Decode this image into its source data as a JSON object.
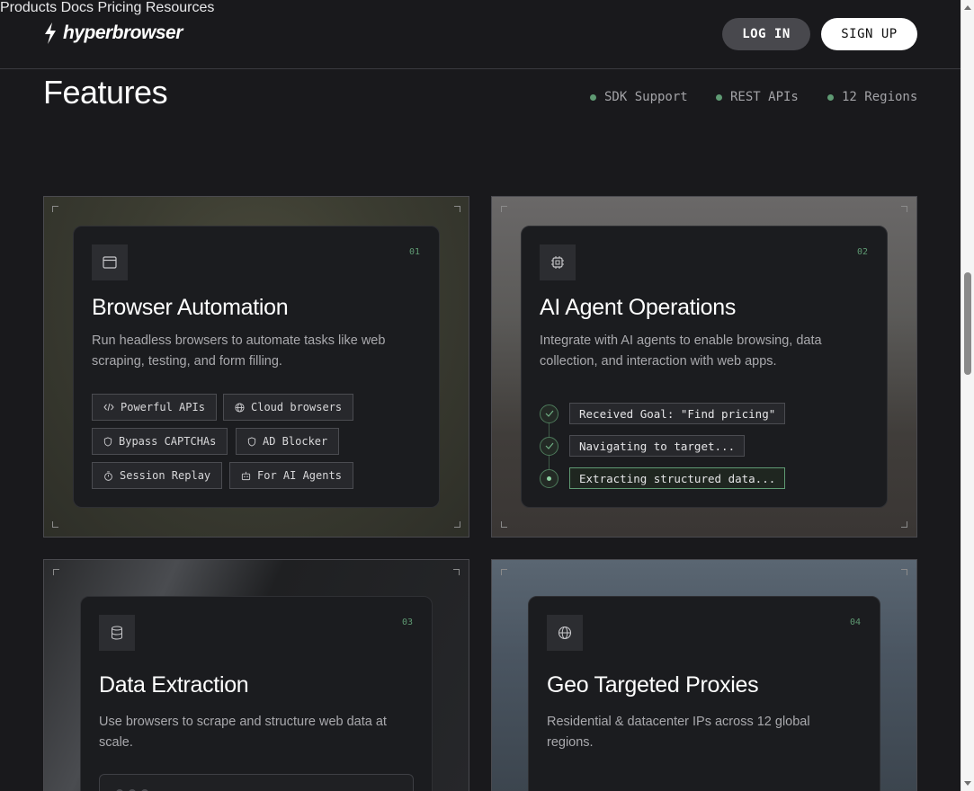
{
  "nav": {
    "logo_text": "hyperbrowser",
    "links": [
      "Products",
      "Docs",
      "Pricing",
      "Resources"
    ],
    "login_label": "LOG IN",
    "signup_label": "SIGN UP"
  },
  "header": {
    "title": "Features",
    "badges": [
      "SDK Support",
      "REST APIs",
      "12 Regions"
    ]
  },
  "colors": {
    "accent": "#5f9a73",
    "background": "#19191c",
    "card": "#1b1c1f"
  },
  "features": [
    {
      "num": "01",
      "icon": "browser-window-icon",
      "title": "Browser Automation",
      "desc": "Run headless browsers to automate tasks like web scraping, testing, and form filling.",
      "tags": [
        {
          "icon": "code-icon",
          "label": "Powerful APIs"
        },
        {
          "icon": "globe-icon",
          "label": "Cloud browsers"
        },
        {
          "icon": "shield-icon",
          "label": "Bypass CAPTCHAs"
        },
        {
          "icon": "shield-icon",
          "label": "AD Blocker"
        },
        {
          "icon": "timer-icon",
          "label": "Session Replay"
        },
        {
          "icon": "robot-icon",
          "label": "For AI Agents"
        }
      ]
    },
    {
      "num": "02",
      "icon": "cpu-icon",
      "title": "AI Agent Operations",
      "desc": "Integrate with AI agents to enable browsing, data collection, and interaction with web apps.",
      "steps": [
        "Received Goal: \"Find pricing\"",
        "Navigating to target...",
        "Extracting structured data..."
      ]
    },
    {
      "num": "03",
      "icon": "database-icon",
      "title": "Data Extraction",
      "desc": "Use browsers to scrape and structure web data at scale."
    },
    {
      "num": "04",
      "icon": "globe-icon",
      "title": "Geo Targeted Proxies",
      "desc": "Residential & datacenter IPs across 12 global regions."
    }
  ]
}
